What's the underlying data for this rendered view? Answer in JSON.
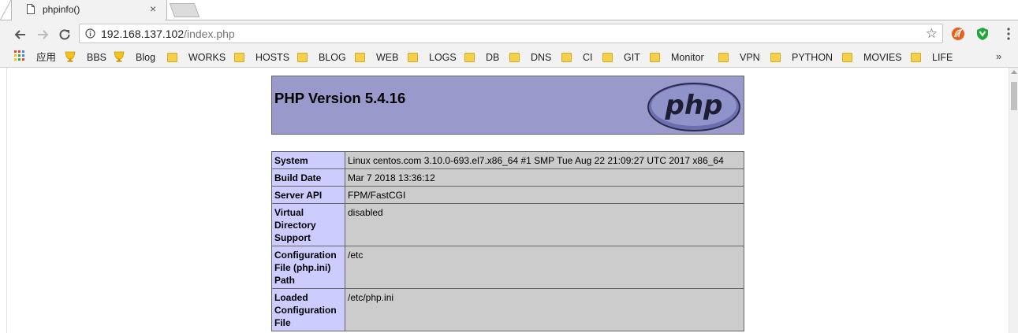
{
  "tab": {
    "title": "phpinfo()",
    "close": "×"
  },
  "address_bar": {
    "host": "192.168.137.102",
    "path": "/index.php"
  },
  "bookmarks": {
    "apps_label": "应用",
    "items": [
      {
        "label": "BBS",
        "icon": "trophy-icon"
      },
      {
        "label": "Blog",
        "icon": "trophy-icon"
      },
      {
        "label": "WORKS",
        "icon": "folder-icon"
      },
      {
        "label": "HOSTS",
        "icon": "folder-icon"
      },
      {
        "label": "BLOG",
        "icon": "folder-icon"
      },
      {
        "label": "WEB",
        "icon": "folder-icon"
      },
      {
        "label": "LOGS",
        "icon": "folder-icon"
      },
      {
        "label": "DB",
        "icon": "folder-icon"
      },
      {
        "label": "DNS",
        "icon": "folder-icon"
      },
      {
        "label": "CI",
        "icon": "folder-icon"
      },
      {
        "label": "GIT",
        "icon": "folder-icon"
      },
      {
        "label": "Monitor",
        "icon": "folder-icon"
      },
      {
        "label": "VPN",
        "icon": "folder-icon"
      },
      {
        "label": "PYTHON",
        "icon": "folder-icon"
      },
      {
        "label": "MOVIES",
        "icon": "folder-icon"
      },
      {
        "label": "LIFE",
        "icon": "folder-icon"
      }
    ],
    "overflow": "»"
  },
  "phpinfo": {
    "version_title": "PHP Version 5.4.16",
    "logo_text": "php",
    "rows": [
      {
        "key": "System",
        "value": "Linux centos.com 3.10.0-693.el7.x86_64 #1 SMP Tue Aug 22 21:09:27 UTC 2017 x86_64"
      },
      {
        "key": "Build Date",
        "value": "Mar 7 2018 13:36:12"
      },
      {
        "key": "Server API",
        "value": "FPM/FastCGI"
      },
      {
        "key": "Virtual Directory Support",
        "value": "disabled"
      },
      {
        "key": "Configuration File (php.ini) Path",
        "value": "/etc"
      },
      {
        "key": "Loaded Configuration File",
        "value": "/etc/php.ini"
      }
    ]
  },
  "colors": {
    "php_header": "#9999cc",
    "key_cell": "#ccccff",
    "value_cell": "#cccccc",
    "chrome_toolbar": "#f2f2f2"
  }
}
